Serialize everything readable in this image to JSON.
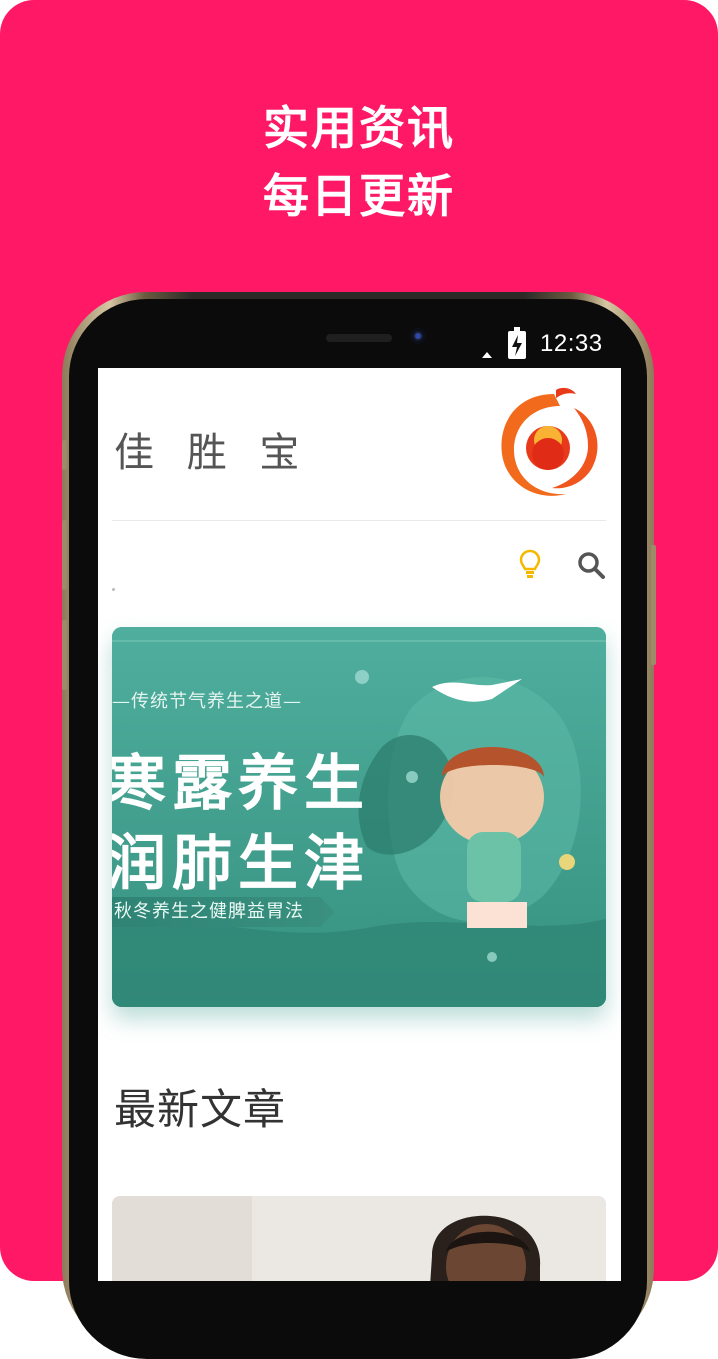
{
  "promo": {
    "headline_line1": "实用资讯",
    "headline_line2": "每日更新",
    "background_color": "#fe1865"
  },
  "status_bar": {
    "time": "12:33",
    "battery_icon": "battery-charging-icon",
    "signal_icon": "signal-icon"
  },
  "app": {
    "title": "佳 胜 宝",
    "logo_icon": "brand-logo-icon",
    "tip_icon": "lightbulb-icon",
    "search_icon": "search-icon"
  },
  "banner": {
    "top_text": "—传统节气养生之道—",
    "big_line1": "寒露养生",
    "big_line2": "润肺生津",
    "subtitle": "秋冬养生之健脾益胃法"
  },
  "section": {
    "title": "最新文章"
  },
  "colors": {
    "accent_pink": "#fe1865",
    "banner_teal": "#3f9f90",
    "logo_orange": "#f0551e"
  }
}
